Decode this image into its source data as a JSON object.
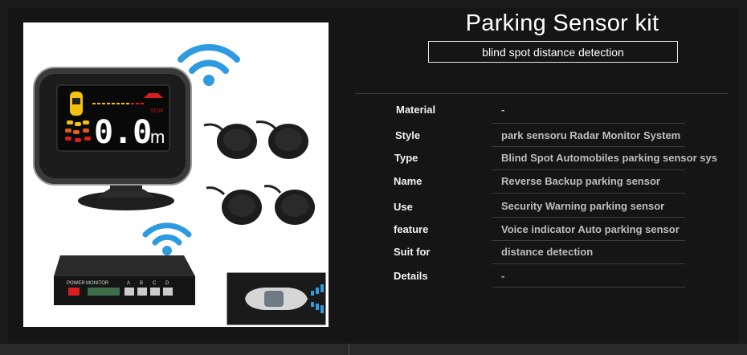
{
  "header": {
    "title": "Parking Sensor kit",
    "subtitle": "blind spot distance detection"
  },
  "display": {
    "reading": "0.0",
    "unit": "m",
    "stop_label": "STOP"
  },
  "control_box": {
    "labels": [
      "POWER",
      "MONITOR",
      "A",
      "B",
      "C",
      "D"
    ]
  },
  "specs": [
    {
      "label": "Material",
      "value": "-"
    },
    {
      "label": "Style",
      "value": "park sensoru Radar Monitor System"
    },
    {
      "label": "Type",
      "value": "Blind Spot Automobiles parking sensor sys"
    },
    {
      "label": "Name",
      "value": "Reverse Backup parking sensor"
    },
    {
      "label": "Use",
      "value": "Security Warning parking sensor"
    },
    {
      "label": "feature",
      "value": "Voice indicator Auto parking sensor"
    },
    {
      "label": "Suit for",
      "value": "distance detection"
    },
    {
      "label": "Details",
      "value": "-"
    }
  ],
  "colors": {
    "accent_blue": "#2e9be0",
    "background": "#151515",
    "display_red": "#ffffff"
  }
}
